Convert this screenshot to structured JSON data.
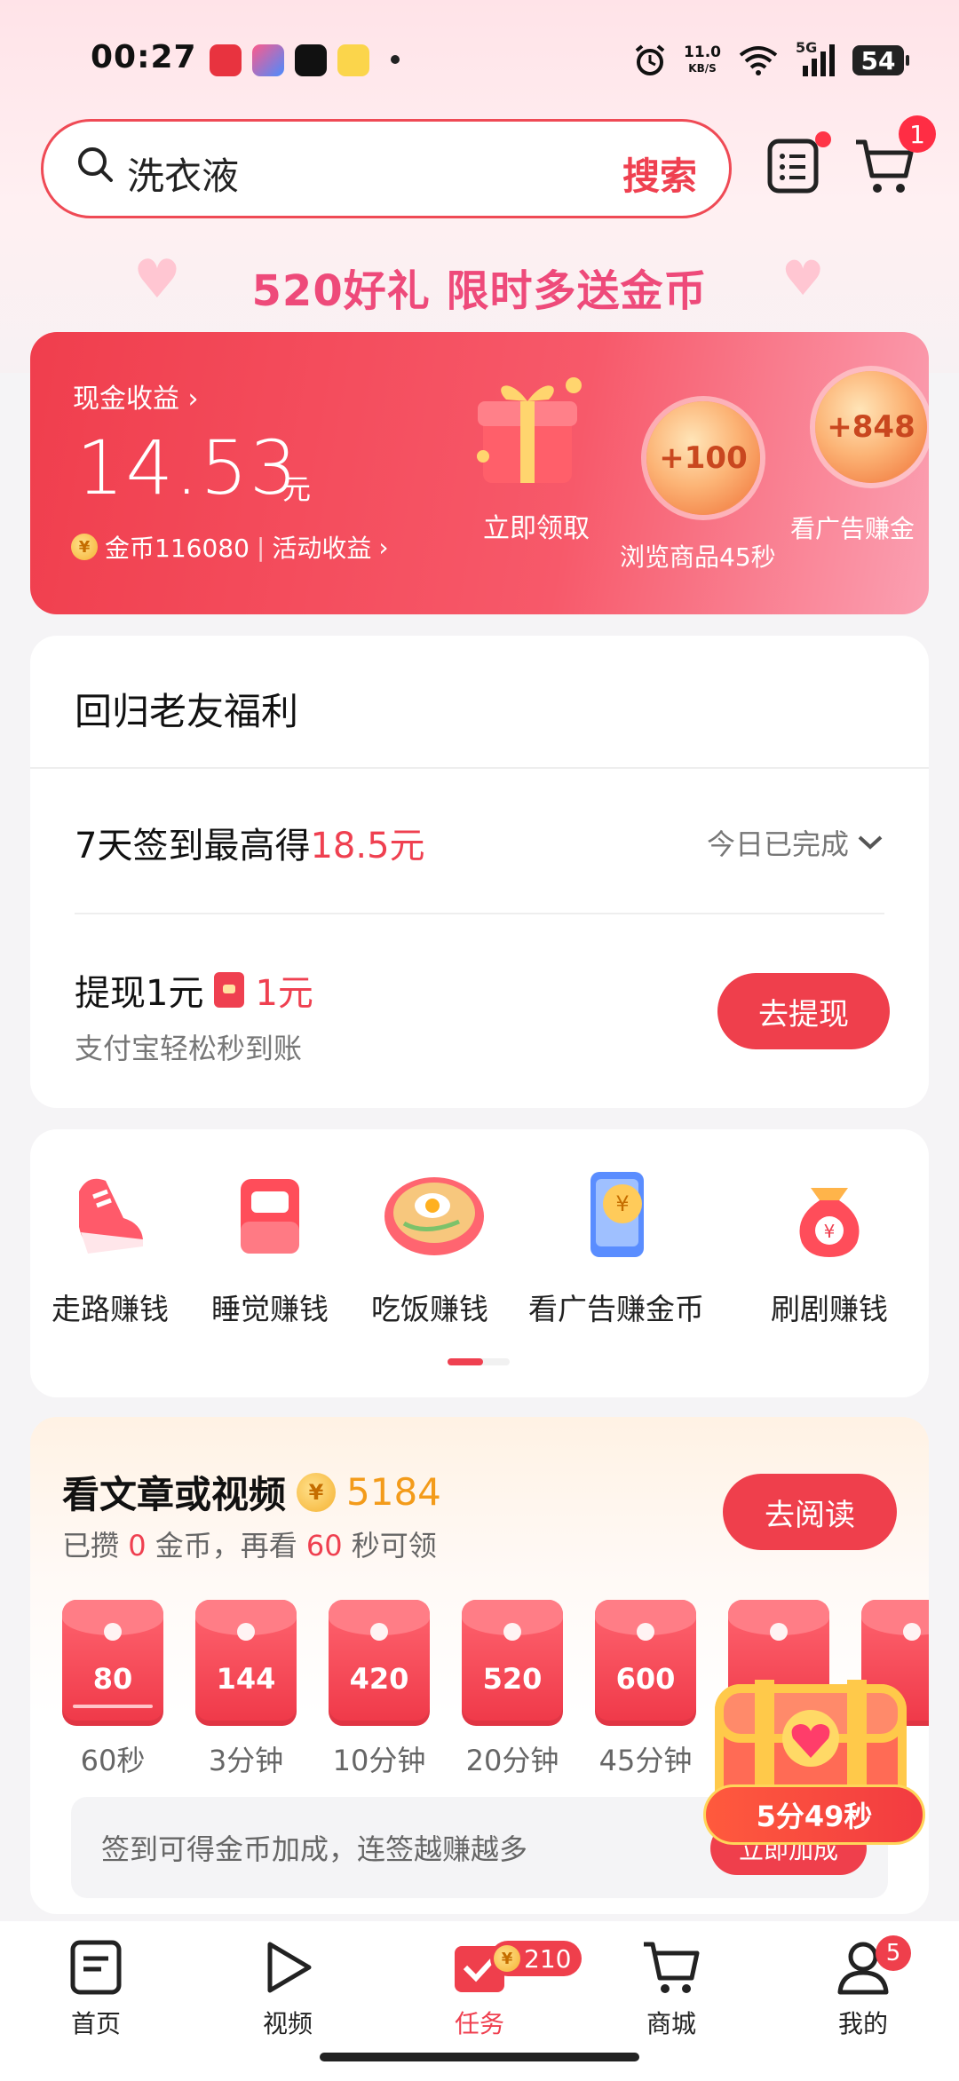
{
  "status_bar": {
    "time": "00:27",
    "net_speed_value": "11.0",
    "net_speed_unit": "KB/S",
    "network": "5G",
    "battery": "54"
  },
  "search": {
    "query": "洗衣液",
    "button_label": "搜索"
  },
  "header": {
    "cart_badge": "1",
    "promo_text": "520好礼 限时多送金币"
  },
  "earnings": {
    "title": "现金收益",
    "amount": "14.53",
    "unit": "元",
    "coins_label": "金币116080",
    "activity_label": "活动收益",
    "gift_label": "立即领取",
    "bubble1_value": "+100",
    "bubble1_label": "浏览商品45秒",
    "bubble2_value": "+848",
    "bubble2_label": "看广告赚金"
  },
  "welfare": {
    "title": "回归老友福利",
    "sign_prefix": "7天签到最高得",
    "sign_amount": "18.5元",
    "sign_status": "今日已完成",
    "withdraw_title": "提现1元",
    "withdraw_amount": "1元",
    "withdraw_sub": "支付宝轻松秒到账",
    "withdraw_button": "去提现"
  },
  "categories": [
    {
      "label": "走路赚钱",
      "icon": "shoe-icon"
    },
    {
      "label": "睡觉赚钱",
      "icon": "bed-icon"
    },
    {
      "label": "吃饭赚钱",
      "icon": "noodle-bowl-icon"
    },
    {
      "label": "看广告赚金币",
      "icon": "phone-coin-icon"
    },
    {
      "label": "刷剧赚钱",
      "icon": "money-bag-icon"
    }
  ],
  "reading": {
    "title": "看文章或视频",
    "coins": "5184",
    "sub_prefix": "已攒",
    "sub_coins": "0",
    "sub_middle": "金币，再看",
    "sub_seconds": "60",
    "sub_suffix": "秒可领",
    "button": "去阅读",
    "envelopes": [
      {
        "value": "80",
        "time": "60秒"
      },
      {
        "value": "144",
        "time": "3分钟"
      },
      {
        "value": "420",
        "time": "10分钟"
      },
      {
        "value": "520",
        "time": "20分钟"
      },
      {
        "value": "600",
        "time": "45分钟"
      }
    ],
    "tip_text": "签到可得金币加成，连签越赚越多",
    "tip_button": "立即加成"
  },
  "floating_timer": "5分49秒",
  "bottom_nav": [
    {
      "label": "首页",
      "icon": "home-doc-icon"
    },
    {
      "label": "视频",
      "icon": "play-icon"
    },
    {
      "label": "任务",
      "icon": "task-check-icon",
      "badge": "210"
    },
    {
      "label": "商城",
      "icon": "cart-icon"
    },
    {
      "label": "我的",
      "icon": "person-icon",
      "badge": "5"
    }
  ],
  "colors": {
    "accent": "#ef4050",
    "coin": "#f5b233"
  }
}
